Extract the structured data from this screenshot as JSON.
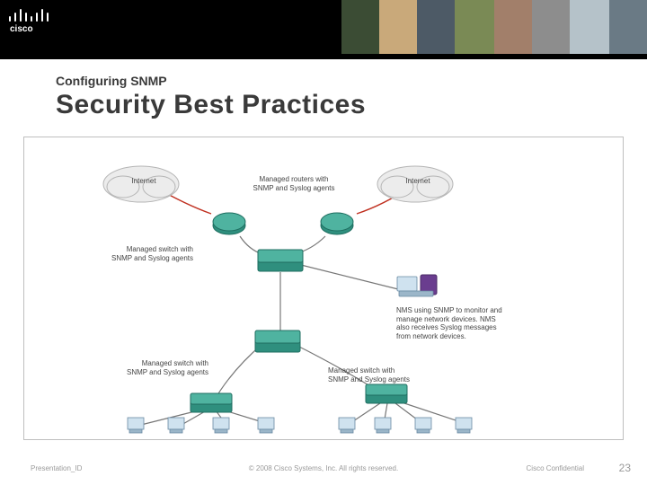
{
  "header": {
    "brand": "cisco"
  },
  "subtitle": "Configuring SNMP",
  "title": "Security Best Practices",
  "diagram": {
    "cloud_left_label": "Internet",
    "cloud_right_label": "Internet",
    "managed_routers_label": "Managed routers with\nSNMP and Syslog agents",
    "managed_switch_label": "Managed switch with\nSNMP and Syslog agents",
    "nms_label": "NMS using SNMP to monitor and\nmanage network devices. NMS\nalso receives Syslog messages\nfrom network devices.",
    "managed_switch_label_2": "Managed switch with\nSNMP and Syslog agents",
    "managed_switch_label_3": "Managed switch with\nSNMP and Syslog agents"
  },
  "footer": {
    "presentation_id": "Presentation_ID",
    "copyright": "© 2008 Cisco Systems, Inc. All rights reserved.",
    "confidential": "Cisco Confidential",
    "slide_number": "23"
  },
  "colors": {
    "device_green": "#2f8f7e",
    "link_red": "#c03020",
    "pc_blue": "#cfe2ef"
  }
}
